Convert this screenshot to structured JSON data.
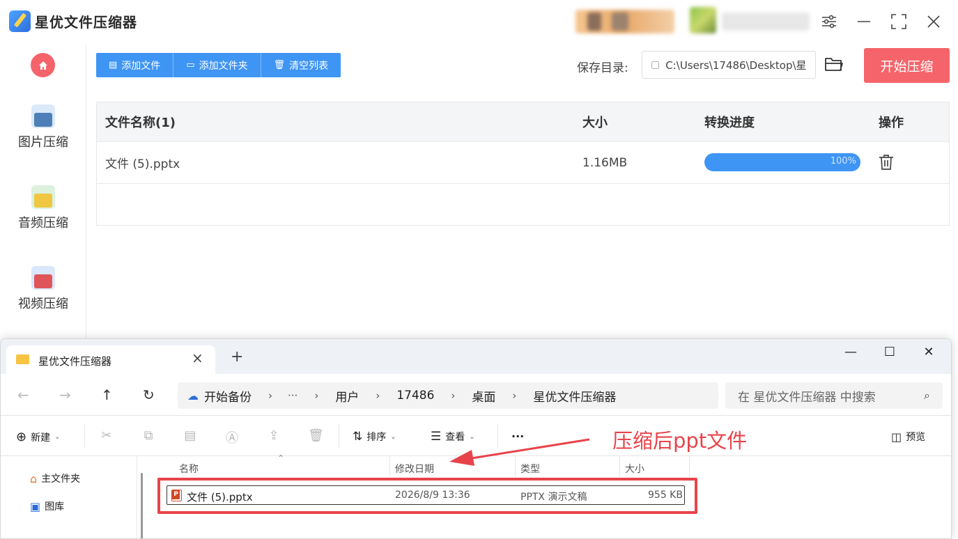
{
  "app": {
    "title": "星优文件压缩器",
    "accent_color": "#3f95f4",
    "danger_color": "#f4646a"
  },
  "sidebar": {
    "home_icon": "home-icon",
    "items": [
      {
        "label": "图片压缩",
        "icon": "image-icon"
      },
      {
        "label": "音频压缩",
        "icon": "music-icon"
      },
      {
        "label": "视频压缩",
        "icon": "video-icon"
      }
    ]
  },
  "toolbar": {
    "add_file": "添加文件",
    "add_folder": "添加文件夹",
    "clear_list": "清空列表",
    "save_label": "保存目录:",
    "save_path": "C:\\Users\\17486\\Desktop\\星",
    "start_button": "开始压缩"
  },
  "table": {
    "headers": [
      "文件名称(1)",
      "大小",
      "转换进度",
      "操作"
    ],
    "rows": [
      {
        "name": "文件 (5).pptx",
        "size": "1.16MB",
        "progress_label": "100%",
        "progress_fraction": 1.0
      }
    ]
  },
  "explorer": {
    "tab_title": "星优文件压缩器",
    "address": {
      "root": "开始备份",
      "ellipsis": "···",
      "segments": [
        "用户",
        "17486",
        "桌面",
        "星优文件压缩器"
      ]
    },
    "search_placeholder": "在 星优文件压缩器 中搜索",
    "commands": {
      "new": "新建",
      "sort": "排序",
      "view": "查看",
      "more": "···",
      "preview": "预览"
    },
    "nav": [
      {
        "label": "主文件夹",
        "icon": "home-icon"
      },
      {
        "label": "图库",
        "icon": "gallery-icon"
      }
    ],
    "columns": [
      "名称",
      "修改日期",
      "类型",
      "大小"
    ],
    "files": [
      {
        "name": "文件 (5).pptx",
        "modified": "2026/8/9 13:36",
        "type": "PPTX 演示文稿",
        "size": "955 KB"
      }
    ]
  },
  "annotation": {
    "text": "压缩后ppt文件",
    "color": "#e8434a"
  }
}
